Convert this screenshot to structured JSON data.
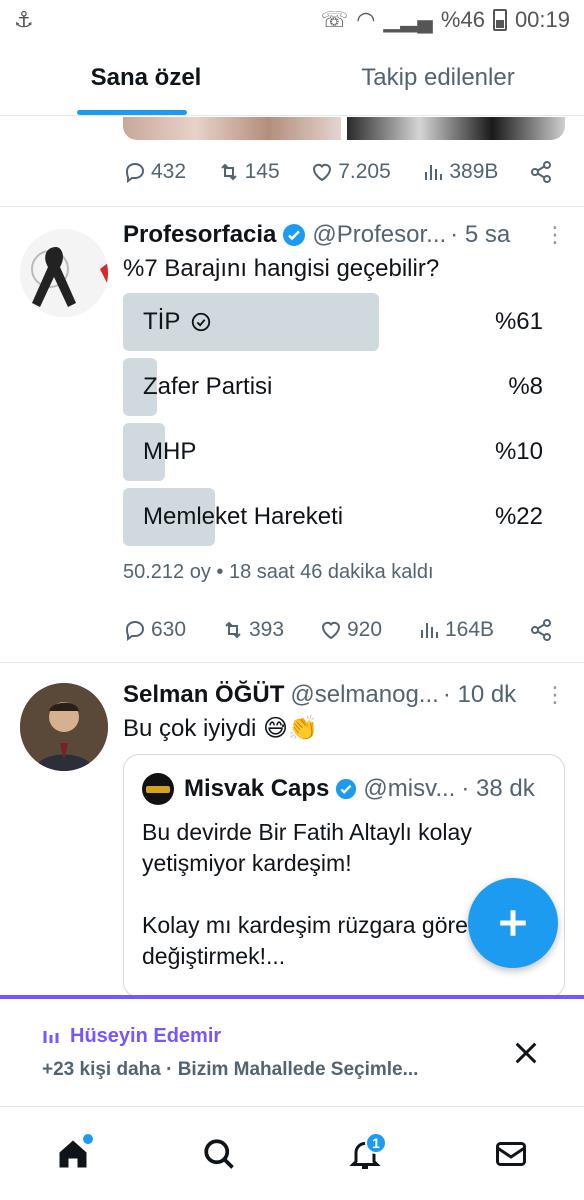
{
  "status_bar": {
    "battery": "%46",
    "time": "00:19"
  },
  "tabs": [
    {
      "label": "Sana özel",
      "active": true
    },
    {
      "label": "Takip edilenler",
      "active": false
    }
  ],
  "prev_tweet": {
    "replies": "432",
    "retweets": "145",
    "likes": "7.205",
    "views": "389B"
  },
  "poll_tweet": {
    "name": "Profesorfacia",
    "handle": "@Profesor...",
    "time": "· 5 sa",
    "text": "%7 Barajını hangisi geçebilir?",
    "options": [
      {
        "label": "TİP",
        "pct": "%61",
        "fraction": 0.61,
        "selected": true
      },
      {
        "label": "Zafer Partisi",
        "pct": "%8",
        "fraction": 0.08,
        "selected": false
      },
      {
        "label": "MHP",
        "pct": "%10",
        "fraction": 0.1,
        "selected": false
      },
      {
        "label": "Memleket Hareketi",
        "pct": "%22",
        "fraction": 0.22,
        "selected": false
      }
    ],
    "meta": "50.212 oy • 18 saat 46 dakika kaldı",
    "replies": "630",
    "retweets": "393",
    "likes": "920",
    "views": "164B"
  },
  "quote_tweet": {
    "name": "Selman ÖĞÜT",
    "handle": "@selmanog...",
    "time": "· 10 dk",
    "text": "Bu çok iyiydi 😅👏",
    "quoted": {
      "name": "Misvak Caps",
      "handle": "@misv...",
      "time": "· 38 dk",
      "text": "Bu devirde Bir Fatih Altaylı kolay yetişmiyor kardeşim!\n\nKolay mı kardeşim rüzgara göre şekil değiştirmek!..."
    }
  },
  "space": {
    "host": "Hüseyin Edemir",
    "meta": "+23 kişi daha · Bizim Mahallede Seçimle..."
  },
  "nav": {
    "notifications_badge": "1"
  },
  "colors": {
    "accent": "#1d9bf0",
    "space": "#7856ff",
    "poll_bar": "#cfd9de"
  }
}
